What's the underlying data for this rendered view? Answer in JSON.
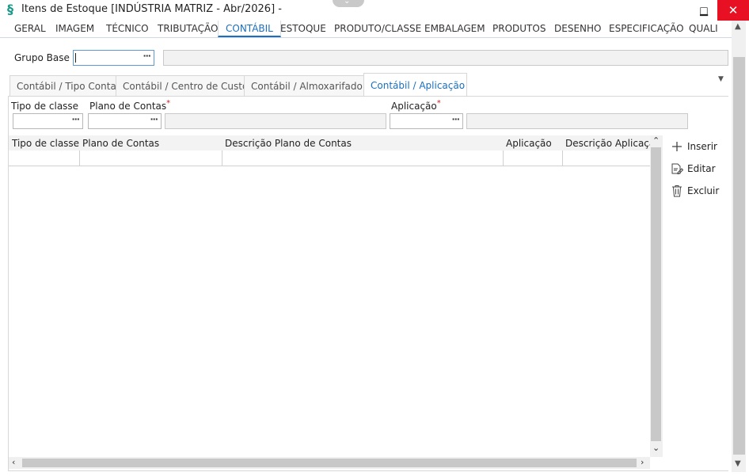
{
  "window": {
    "title": "Itens de Estoque [INDÚSTRIA MATRIZ - Abr/2026]  -",
    "minimize": "▁",
    "maximize": "□",
    "close": "✕"
  },
  "top_tabs": [
    {
      "label": "GERAL",
      "active": false
    },
    {
      "label": "IMAGEM",
      "active": false
    },
    {
      "label": "TÉCNICO",
      "active": false
    },
    {
      "label": "TRIBUTAÇÃO",
      "active": false
    },
    {
      "label": "CONTÁBIL",
      "active": true
    },
    {
      "label": "ESTOQUE",
      "active": false
    },
    {
      "label": "PRODUTO/CLASSE",
      "active": false
    },
    {
      "label": "EMBALAGEM",
      "active": false
    },
    {
      "label": "PRODUTOS",
      "active": false
    },
    {
      "label": "DESENHO",
      "active": false
    },
    {
      "label": "ESPECIFICAÇÃO",
      "active": false
    },
    {
      "label": "QUALI",
      "active": false
    }
  ],
  "grupo_base": {
    "label": "Grupo Base",
    "value": "",
    "lookup": "···"
  },
  "sub_tabs": [
    {
      "label": "Contábil / Tipo Conta",
      "active": false
    },
    {
      "label": "Contábil / Centro de Custo",
      "active": false
    },
    {
      "label": "Contábil / Almoxarifado",
      "active": false
    },
    {
      "label": "Contábil / Aplicação",
      "active": true
    }
  ],
  "filters": {
    "tipo_classe": {
      "label": "Tipo de classe",
      "value": "",
      "lookup": "···"
    },
    "plano_contas": {
      "label": "Plano de Contas",
      "required": "*",
      "value": "",
      "lookup": "···"
    },
    "aplicacao": {
      "label": "Aplicação",
      "required": "*",
      "value": "",
      "lookup": "···"
    }
  },
  "grid": {
    "columns": [
      "Tipo de classe",
      "Plano de Contas",
      "Descrição Plano de Contas",
      "Aplicação",
      "Descrição Aplicaçã"
    ],
    "rows": []
  },
  "actions": {
    "insert": "Inserir",
    "edit": "Editar",
    "delete": "Excluir"
  },
  "colors": {
    "accent": "#1a6fbf",
    "close": "#e81123",
    "brand": "#1b9a8a"
  }
}
